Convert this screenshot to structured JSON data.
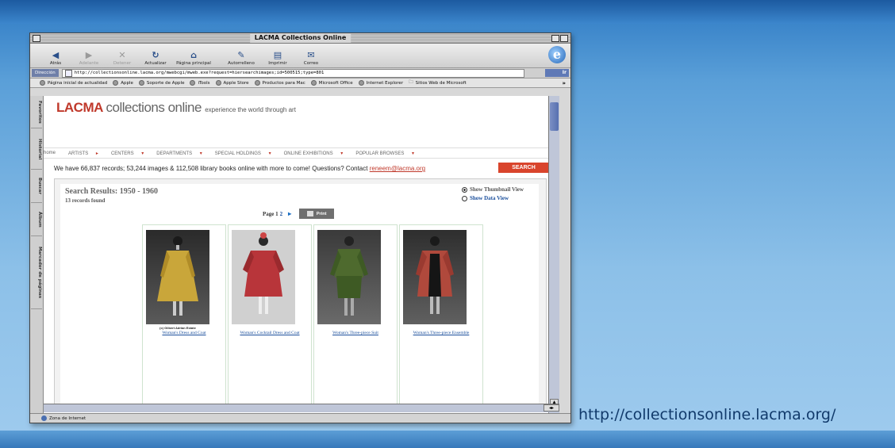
{
  "window": {
    "title": "LACMA Collections Online"
  },
  "toolbar": {
    "buttons": [
      {
        "label": "Atrás",
        "icon": "back-arrow-icon"
      },
      {
        "label": "Adelante",
        "icon": "forward-arrow-icon"
      },
      {
        "label": "Detener",
        "icon": "stop-icon"
      },
      {
        "label": "Actualizar",
        "icon": "refresh-icon"
      },
      {
        "label": "Página principal",
        "icon": "home-icon"
      },
      {
        "label": "Autorrelleno",
        "icon": "autofill-icon"
      },
      {
        "label": "Imprimir",
        "icon": "print-icon"
      },
      {
        "label": "Correo",
        "icon": "mail-icon"
      }
    ]
  },
  "address": {
    "label": "Dirección",
    "url": "http://collectionsonline.lacma.org/mwebcgi/mweb.exe?request=hiersearchimages;id=500515;type=801",
    "go_label": "Ir"
  },
  "favorites": [
    "Página inicial de actualidad",
    "Apple",
    "Soporte de Apple",
    "iTools",
    "Apple Store",
    "Productos para Mac",
    "Microsoft Office",
    "Internet Explorer",
    "Sitios Web de Microsoft"
  ],
  "sidebar_tabs": [
    "Favoritos",
    "Historial",
    "Buscar",
    "Álbum",
    "Marcador de páginas"
  ],
  "site": {
    "logo_mark": "LACMA",
    "logo_text": "collections online",
    "tagline": "experience the world through art",
    "nav": [
      {
        "label": "home",
        "caret": ""
      },
      {
        "label": "ARTISTS",
        "caret": "▸"
      },
      {
        "label": "CENTERS",
        "caret": "▾"
      },
      {
        "label": "DEPARTMENTS",
        "caret": "▾"
      },
      {
        "label": "SPECIAL HOLDINGS",
        "caret": "▾"
      },
      {
        "label": "ONLINE EXHIBITIONS",
        "caret": "▾"
      },
      {
        "label": "POPULAR BROWSES",
        "caret": "▾"
      }
    ],
    "records_text": "We have 66,837 records; 53,244 images & 112,508 library books online with more to come! Questions? Contact",
    "contact_email": "reneem@lacma.org",
    "search_label": "SEARCH"
  },
  "results": {
    "title": "Search Results: 1950 - 1960",
    "count": "13 records found",
    "view_options": [
      {
        "label": "Show Thumbnail View",
        "selected": true
      },
      {
        "label": "Show Data View",
        "selected": false
      }
    ],
    "page_label": "Page",
    "current_page": "1",
    "next_page": "2",
    "print_label": "Print",
    "items": [
      {
        "caption": "Woman's Dress and Coat",
        "credit": "(c) Gilbert Adrian Estate",
        "color": "#c9a63a"
      },
      {
        "caption": "Woman's Cocktail Dress and Coat",
        "credit": "",
        "color": "#b8353a"
      },
      {
        "caption": "Woman's Three-piece Suit",
        "credit": "",
        "color": "#4e6a2e"
      },
      {
        "caption": "Woman's Three-piece Ensemble",
        "credit": "",
        "color": "#b0493c"
      }
    ]
  },
  "status": {
    "text": "Zona de Internet"
  },
  "caption_url": "http://collectionsonline.lacma.org/"
}
